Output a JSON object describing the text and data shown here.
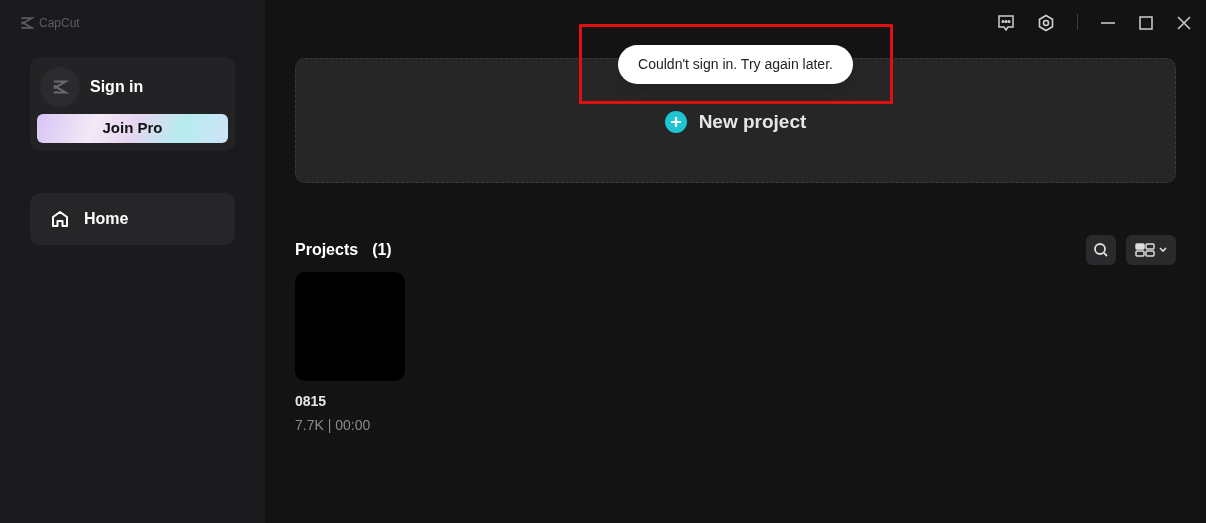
{
  "app": {
    "logo_text": "CapCut"
  },
  "account": {
    "sign_in": "Sign in",
    "join_pro": "Join Pro"
  },
  "sidebar": {
    "items": [
      {
        "label": "Home",
        "selected": true
      }
    ]
  },
  "new_project": {
    "label": "New project"
  },
  "toast": {
    "text": "Couldn't sign in. Try again later.",
    "highlighted": true
  },
  "projects": {
    "title": "Projects",
    "count": "(1)",
    "items": [
      {
        "name": "0815",
        "meta": "7.7K | 00:00"
      }
    ]
  }
}
